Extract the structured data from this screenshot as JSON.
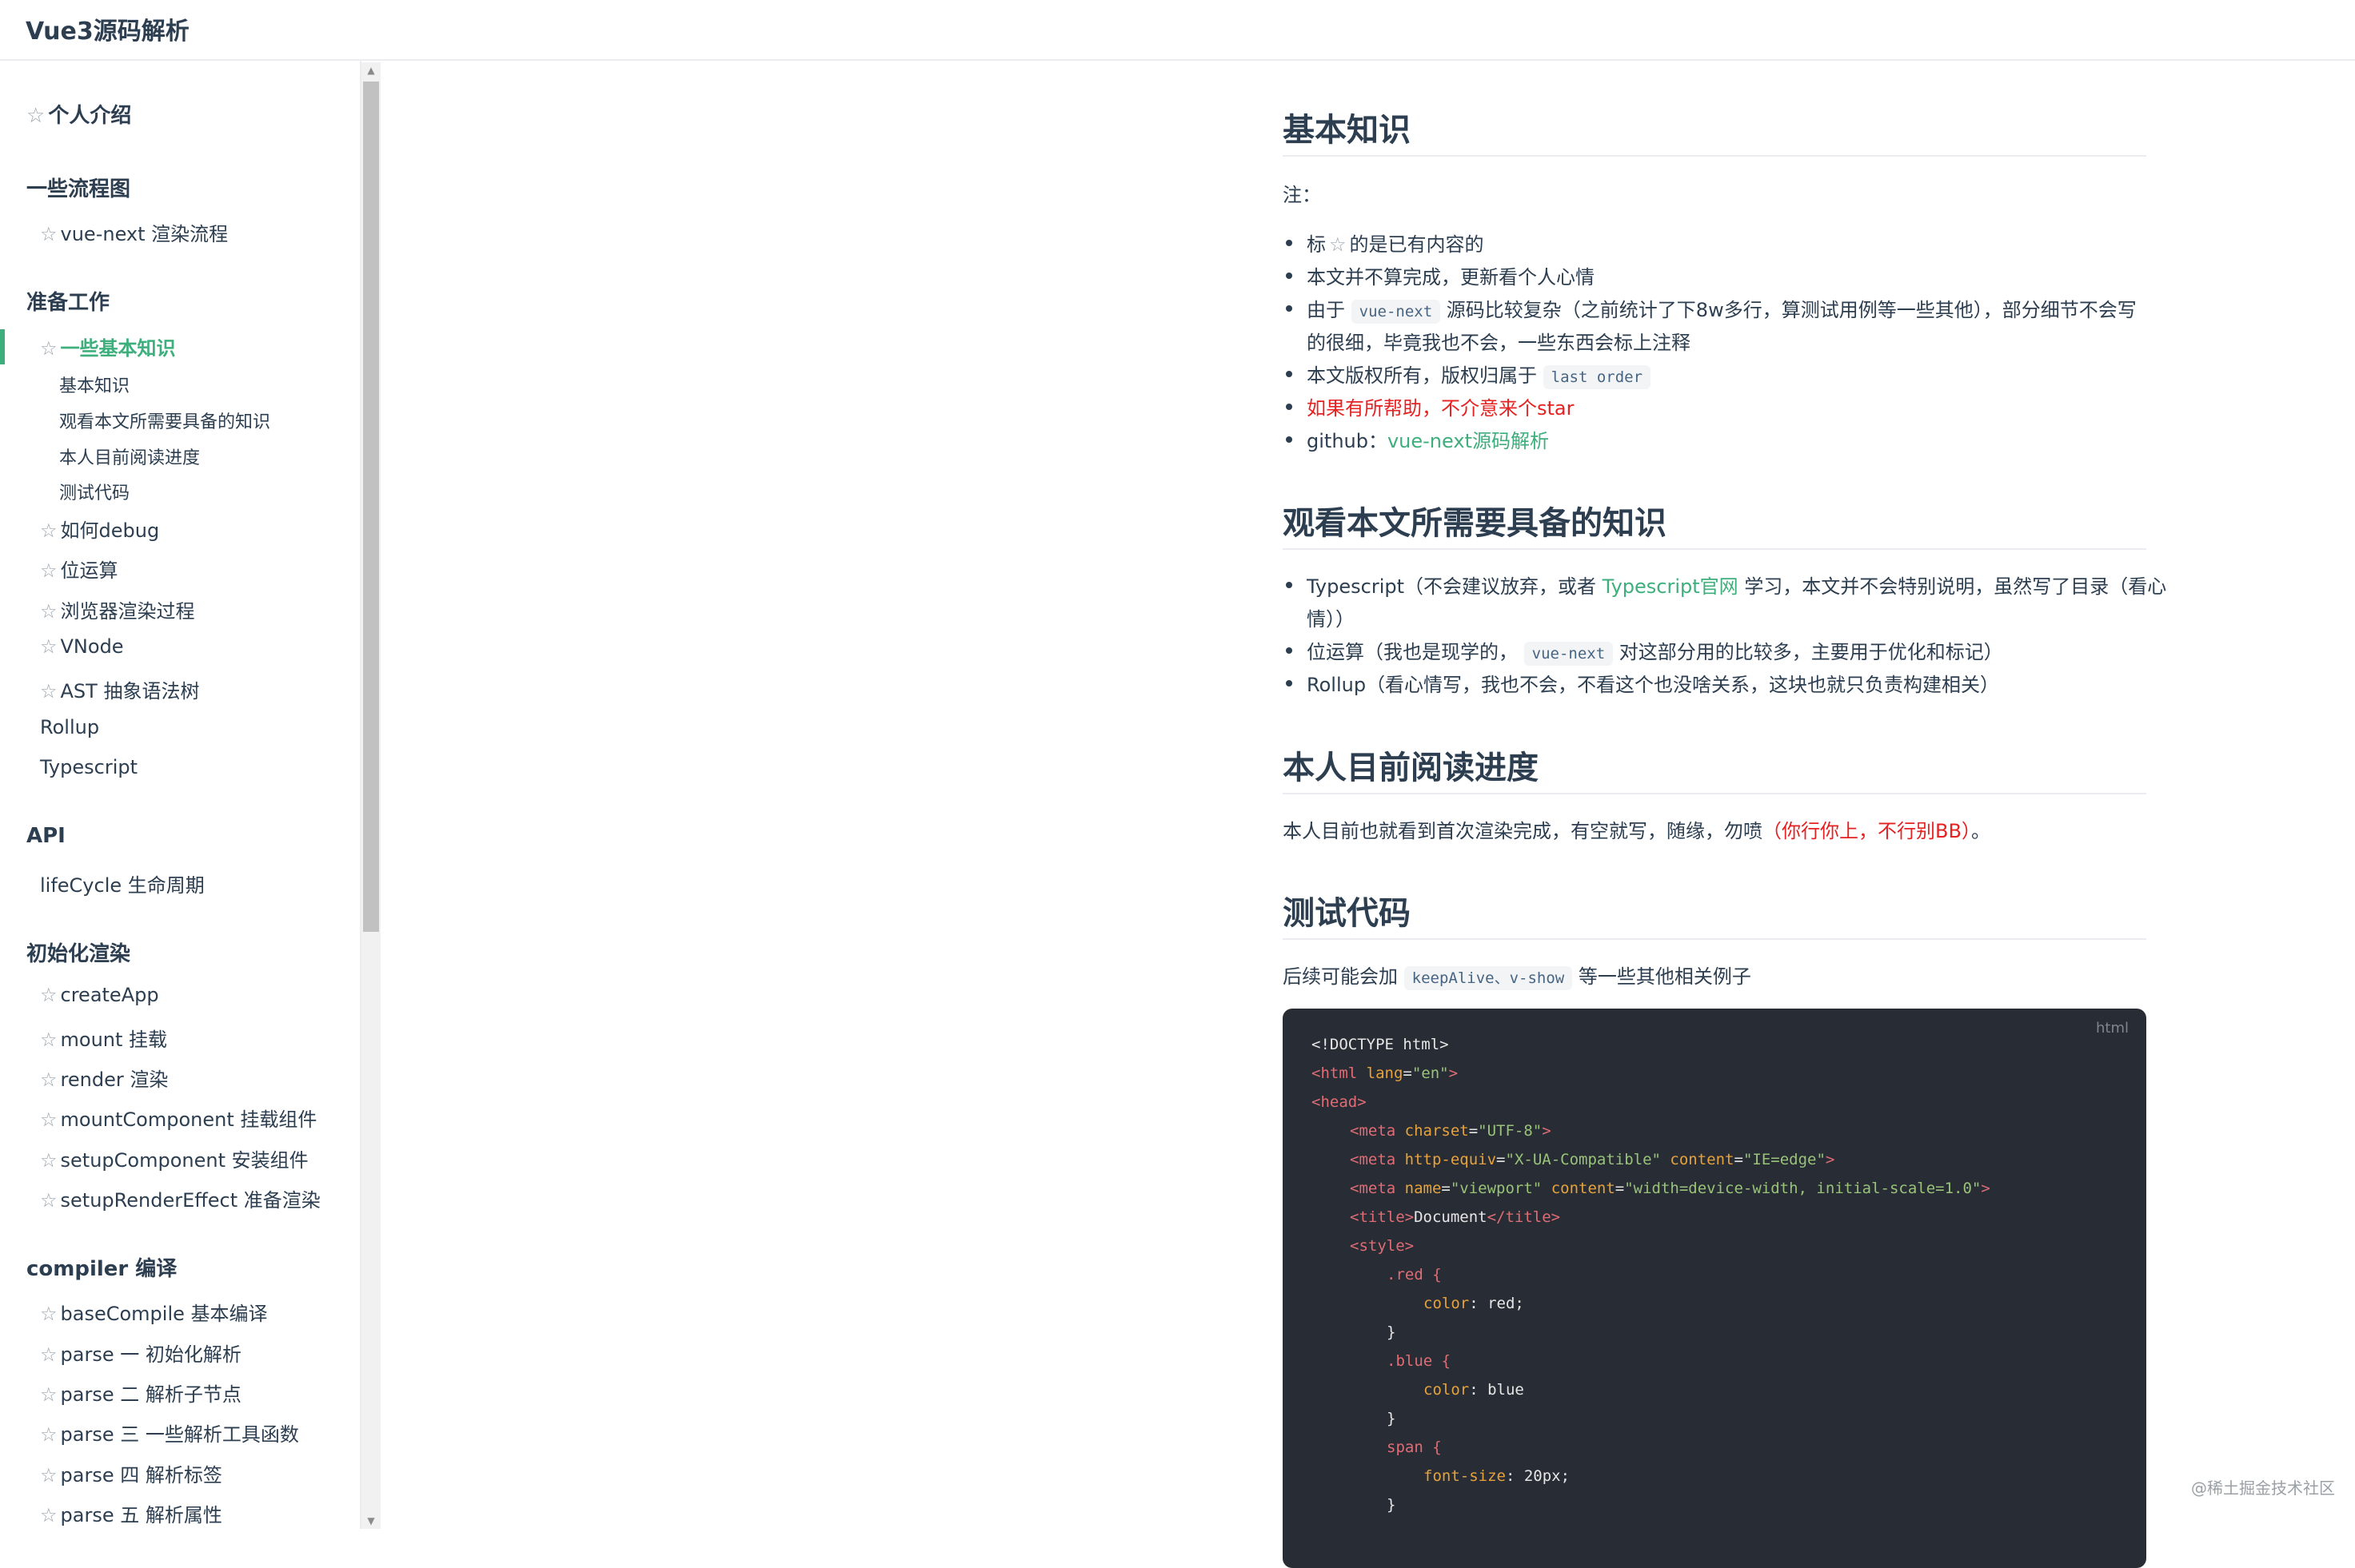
{
  "header": {
    "title": "Vue3源码解析"
  },
  "sidebar": {
    "star": "☆",
    "intro": "个人介绍",
    "groups": {
      "flow": "一些流程图",
      "prep": "准备工作",
      "api": "API",
      "init": "初始化渲染",
      "compiler": "compiler 编译"
    },
    "flow_items": [
      "vue-next 渲染流程"
    ],
    "prep_items": [
      "一些基本知识",
      "如何debug",
      "位运算",
      "浏览器渲染过程",
      "VNode",
      "AST 抽象语法树",
      "Rollup",
      "Typescript"
    ],
    "prep_subitems": [
      "基本知识",
      "观看本文所需要具备的知识",
      "本人目前阅读进度",
      "测试代码"
    ],
    "api_items": [
      "lifeCycle 生命周期"
    ],
    "init_items": [
      "createApp",
      "mount 挂载",
      "render 渲染",
      "mountComponent 挂载组件",
      "setupComponent 安装组件",
      "setupRenderEffect 准备渲染"
    ],
    "compiler_items": [
      "baseCompile 基本编译",
      "parse 一 初始化解析",
      "parse 二 解析子节点",
      "parse 三 一些解析工具函数",
      "parse 四 解析标签",
      "parse 五 解析属性"
    ]
  },
  "content": {
    "s1": {
      "title": "基本知识",
      "note": "注：",
      "b1_pre": "标",
      "b1_post": "的是已有内容的",
      "b2": "本文并不算完成，更新看个人心情",
      "b3_pre": "由于",
      "b3_code": "vue-next",
      "b3_post": "源码比较复杂（之前统计了下8w多行，算测试用例等一些其他），部分细节不会写",
      "b3_cont": "的很细，毕竟我也不会，一些东西会标上注释",
      "b4_pre": "本文版权所有，版权归属于",
      "b4_code": "last order",
      "b5": "如果有所帮助，不介意来个star",
      "b6_pre": "github：",
      "b6_link": "vue-next源码解析"
    },
    "s2": {
      "title": "观看本文所需要具备的知识",
      "b1_pre": "Typescript（不会建议放弃，或者",
      "b1_link": "Typescript官网",
      "b1_post": "学习，本文并不会特别说明，虽然写了目录（看心",
      "b1_cont": "情））",
      "b2_pre": "位运算（我也是现学的，",
      "b2_code": "vue-next",
      "b2_post": "对这部分用的比较多，主要用于优化和标记）",
      "b3": "Rollup（看心情写，我也不会，不看这个也没啥关系，这块也就只负责构建相关）"
    },
    "s3": {
      "title": "本人目前阅读进度",
      "p_pre": "本人目前也就看到首次渲染完成，有空就写，随缘，勿喷",
      "p_red": "（你行你上，不行别BB）",
      "p_post": "。"
    },
    "s4": {
      "title": "测试代码",
      "p_pre": "后续可能会加",
      "p_code": "keepAlive、v-show",
      "p_post": "等一些其他相关例子"
    }
  },
  "code": {
    "lang": "html",
    "l1": "<!DOCTYPE html>",
    "l2_tag": "<html",
    "l2_attr": " lang",
    "l2_eq": "=",
    "l2_val": "\"en\"",
    "l2_end": ">",
    "l3": "<head>",
    "l4_tag": "<meta",
    "l4_attr": " charset",
    "l4_val": "\"UTF-8\"",
    "l5_tag": "<meta",
    "l5_attr1": " http-equiv",
    "l5_val1": "\"X-UA-Compatible\"",
    "l5_attr2": " content",
    "l5_val2": "\"IE=edge\"",
    "l6_tag": "<meta",
    "l6_attr1": " name",
    "l6_val1": "\"viewport\"",
    "l6_attr2": " content",
    "l6_val2": "\"width=device-width, initial-scale=1.0\"",
    "l7_open": "<title>",
    "l7_text": "Document",
    "l7_close": "</title>",
    "l8": "<style>",
    "l9": ".red {",
    "l10_prop": "color",
    "l10_val": ": red;",
    "l11": "}",
    "l12": ".blue {",
    "l13_prop": "color",
    "l13_val": ": blue",
    "l14": "}",
    "l15": "span {",
    "l16_prop": "font-size",
    "l16_val": ": 20px;",
    "l17": "}"
  },
  "watermark": "@稀土掘金技术社区"
}
